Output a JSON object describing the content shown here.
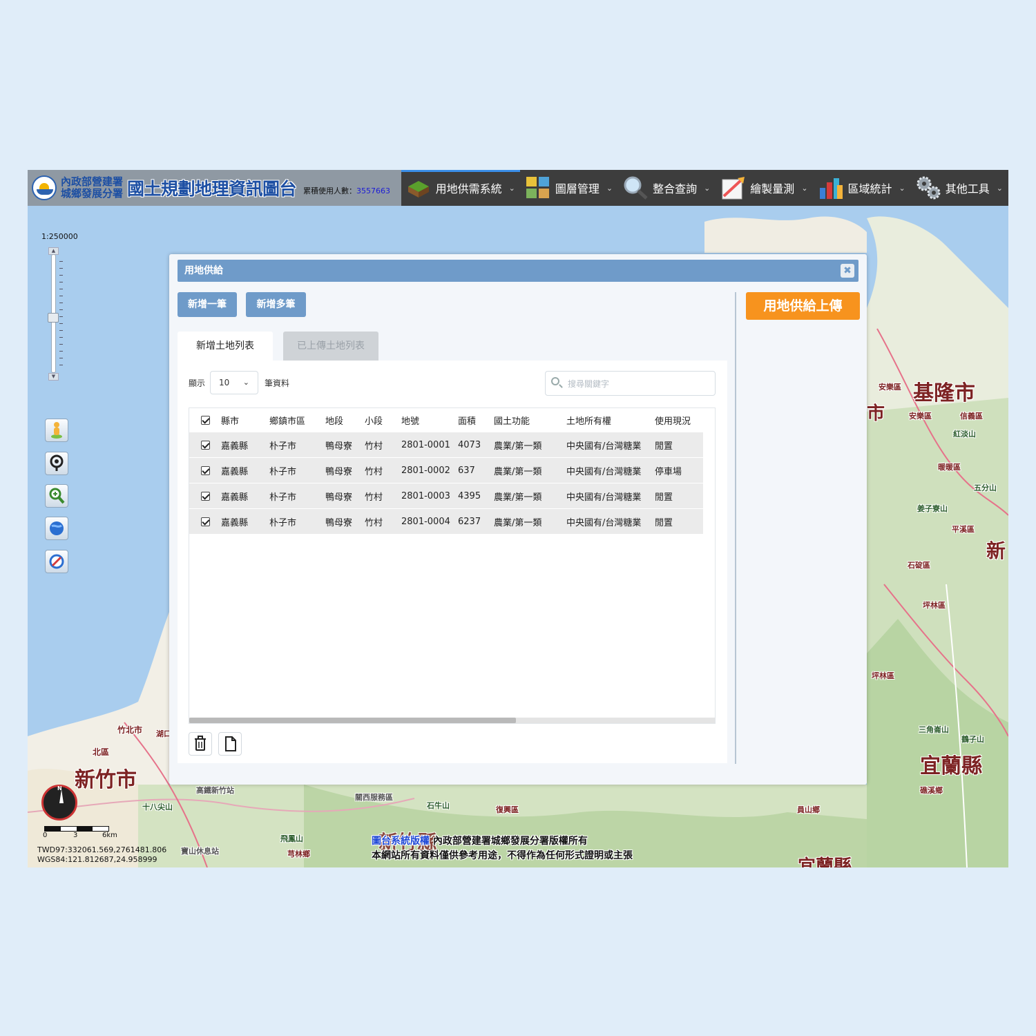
{
  "header": {
    "agency_line1": "內政部營建署",
    "agency_line2": "城鄉發展分署",
    "site_title": "國土規劃地理資訊圖台",
    "counter_label": "累積使用人數：",
    "counter_value": "3557663",
    "nav": [
      {
        "label": "用地供需系統",
        "icon": "land-supply-icon"
      },
      {
        "label": "圖層管理",
        "icon": "layers-icon"
      },
      {
        "label": "整合查詢",
        "icon": "magnifier-icon"
      },
      {
        "label": "繪製量測",
        "icon": "draw-measure-icon"
      },
      {
        "label": "區域統計",
        "icon": "statistics-icon"
      },
      {
        "label": "其他工具",
        "icon": "gears-icon"
      }
    ]
  },
  "map": {
    "scale": "1:250000",
    "coords_twd97": "TWD97:332061.569,2761481.806",
    "coords_wgs84": "WGS84:121.812687,24.958999",
    "scalebar_labels": [
      "0",
      "3",
      "6km"
    ],
    "copyright_link": "圖台系統版權",
    "copyright_owner": "內政部營建署城鄉發展分署版權所有",
    "disclaimer": "本網站所有資料僅供參考用途，不得作為任何形式證明或主張",
    "labels": {
      "hsinchu_city": "新竹市",
      "keelung_city": "基隆市",
      "yilan_county": "宜蘭縣",
      "yilan_county_bottom": "宜蘭縣",
      "hsinchu_county": "新竹縣",
      "new_taipei_partial": "新",
      "taoyuan_partial": "市",
      "north_district": "北區",
      "zhubei": "竹北市",
      "hukou": "湖口",
      "shibashan": "十八尖山",
      "hsr_station": "高鐵新竹站",
      "guanxi_rest": "關西服務區",
      "shiniushan": "石牛山",
      "baoshan_rest": "寶山休息站",
      "feifengshan": "飛鳳山",
      "qionglin": "芎林鄉",
      "fuxing": "復興區",
      "yuanshan": "員山鄉",
      "jiaoxi": "礁溪鄉",
      "pinglin_1": "坪林區",
      "pinglin_2": "坪林區",
      "shiding": "石碇區",
      "pingxi": "平溪區",
      "nuannuan": "暖暖區",
      "anle_1": "安樂區",
      "anle_2": "安樂區",
      "xinyi": "信義區",
      "hongdanshan": "紅淡山",
      "wufenshan": "五分山",
      "jiangzi": "姜子寮山",
      "sanjiaolun": "三角崙山",
      "guizi": "鶴子山"
    }
  },
  "dialog": {
    "title": "用地供給",
    "add_one_label": "新增一筆",
    "add_many_label": "新增多筆",
    "upload_label": "用地供給上傳",
    "tabs": {
      "new_list": "新增土地列表",
      "uploaded_list": "已上傳土地列表"
    },
    "length_prefix": "顯示",
    "length_value": "10",
    "length_suffix": "筆資料",
    "search_placeholder": "搜尋關鍵字",
    "columns": [
      "縣市",
      "鄉鎮市區",
      "地段",
      "小段",
      "地號",
      "面積",
      "國土功能",
      "土地所有權",
      "使用現況"
    ],
    "rows": [
      {
        "checked": true,
        "county": "嘉義縣",
        "town": "朴子市",
        "section": "鴨母寮",
        "subsection": "竹村",
        "lot": "2801-0001",
        "area": "4073",
        "function": "農業/第一類",
        "ownership": "中央國有/台灣糖業",
        "status": "閒置"
      },
      {
        "checked": true,
        "county": "嘉義縣",
        "town": "朴子市",
        "section": "鴨母寮",
        "subsection": "竹村",
        "lot": "2801-0002",
        "area": "637",
        "function": "農業/第一類",
        "ownership": "中央國有/台灣糖業",
        "status": "停車場"
      },
      {
        "checked": true,
        "county": "嘉義縣",
        "town": "朴子市",
        "section": "鴨母寮",
        "subsection": "竹村",
        "lot": "2801-0003",
        "area": "4395",
        "function": "農業/第一類",
        "ownership": "中央國有/台灣糖業",
        "status": "閒置"
      },
      {
        "checked": true,
        "county": "嘉義縣",
        "town": "朴子市",
        "section": "鴨母寮",
        "subsection": "竹村",
        "lot": "2801-0004",
        "area": "6237",
        "function": "農業/第一類",
        "ownership": "中央國有/台灣糖業",
        "status": "閒置"
      }
    ]
  },
  "colors": {
    "header_bg": "#3d3d3d",
    "dialog_title": "#6f9bc9",
    "upload_button": "#f7931e",
    "brand_blue": "#1d4fa3"
  }
}
